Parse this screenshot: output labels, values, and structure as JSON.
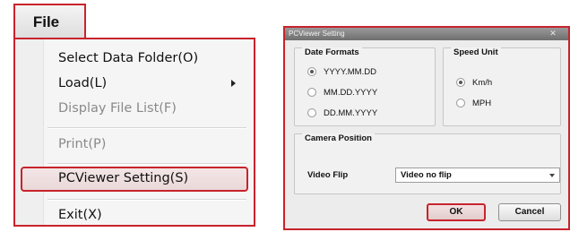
{
  "file_menu": {
    "title": "File",
    "items": [
      {
        "label": "Select Data Folder(O)",
        "enabled": true
      },
      {
        "label": "Load(L)",
        "enabled": true,
        "submenu": true
      },
      {
        "label": "Display File List(F)",
        "enabled": false
      },
      {
        "label": "Print(P)",
        "enabled": false
      },
      {
        "label": "PCViewer Setting(S)",
        "enabled": true,
        "highlighted": true
      },
      {
        "label": "Exit(X)",
        "enabled": true
      }
    ]
  },
  "dialog": {
    "title": "PCViewer Setting",
    "close_glyph": "✕",
    "date_formats": {
      "title": "Date Formats",
      "options": [
        "YYYY.MM.DD",
        "MM.DD.YYYY",
        "DD.MM.YYYY"
      ],
      "selected": "YYYY.MM.DD"
    },
    "speed_unit": {
      "title": "Speed Unit",
      "options": [
        "Km/h",
        "MPH"
      ],
      "selected": "Km/h"
    },
    "camera_position": {
      "title": "Camera Position",
      "video_flip_label": "Video Flip",
      "video_flip_value": "Video no flip"
    },
    "ok_label": "OK",
    "cancel_label": "Cancel"
  },
  "colors": {
    "highlight": "#c8232c"
  }
}
